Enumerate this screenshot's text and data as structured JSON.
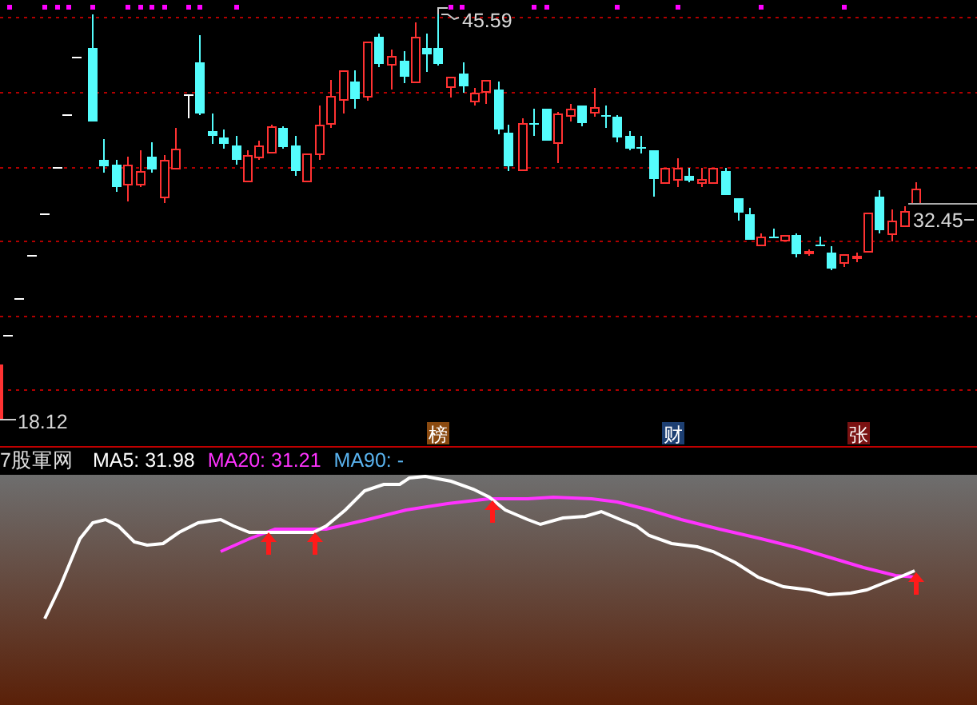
{
  "price_chart": {
    "high_label": "45.59",
    "current_label": "32.45",
    "low_label": "18.12",
    "event_tags": [
      {
        "text": "榜",
        "color": "#8a4a10"
      },
      {
        "text": "财",
        "color": "#1d3f72"
      },
      {
        "text": "张",
        "color": "#7a1212"
      }
    ]
  },
  "indicator_bar": {
    "source": "7股軍网",
    "ma_values": [
      {
        "text": "MA5: 31.98"
      },
      {
        "text": "MA20: 31.21"
      },
      {
        "text": "MA90: -"
      }
    ]
  }
}
